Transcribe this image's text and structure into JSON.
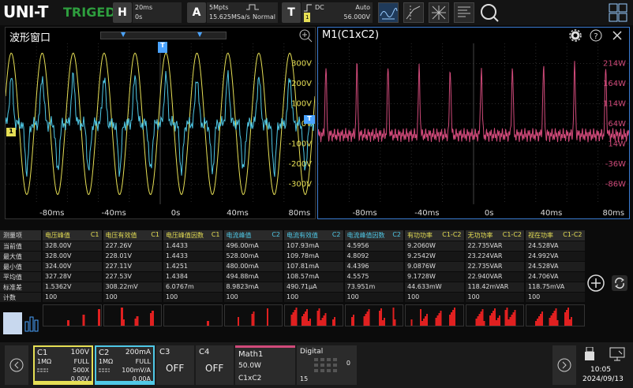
{
  "brand": {
    "name": "UNI-T",
    "status": "TRIGED"
  },
  "horizontal": {
    "letter": "H",
    "timebase": "20ms",
    "offset": "0s"
  },
  "acquire": {
    "letter": "A",
    "depth": "5Mpts",
    "rate": "15.625MSa/s",
    "mode": "Normal"
  },
  "trigger": {
    "letter": "T",
    "coupling": "DC",
    "sweep": "Auto",
    "level": "56.000V",
    "source": "1"
  },
  "tools": [
    "measure-wave-icon",
    "cursor-icon",
    "network-icon",
    "report-icon",
    "zoom-icon",
    "grid-layout-icon"
  ],
  "left_panel": {
    "title": "波形窗口",
    "y_ticks": [
      "300V",
      "200V",
      "100V",
      "0V",
      "-100V",
      "-200V",
      "-300V"
    ],
    "x_ticks": [
      "-80ms",
      "-40ms",
      "0s",
      "40ms",
      "80ms"
    ],
    "ch1_marker": "1",
    "trig_marker": "T"
  },
  "right_panel": {
    "title": "M1(C1xC2)",
    "y_ticks": [
      "214W",
      "164W",
      "114W",
      "64W",
      "14W",
      "-36W",
      "-86W"
    ],
    "x_ticks": [
      "-80ms",
      "-40ms",
      "0s",
      "40ms",
      "80ms"
    ]
  },
  "table": {
    "corner": "测量项",
    "row_labels": [
      "当前值",
      "最大值",
      "最小值",
      "平均值",
      "标准差",
      "计数"
    ],
    "columns": [
      {
        "name": "电压峰值",
        "ch": "C1",
        "color": "#e6df55",
        "values": [
          "328.00V",
          "328.00V",
          "324.00V",
          "327.28V",
          "1.5362V",
          "100"
        ]
      },
      {
        "name": "电压有效值",
        "ch": "C1",
        "color": "#e6df55",
        "values": [
          "227.26V",
          "228.01V",
          "227.11V",
          "227.53V",
          "308.22mV",
          "100"
        ]
      },
      {
        "name": "电压峰值因数",
        "ch": "C1",
        "color": "#e6df55",
        "values": [
          "1.4433",
          "1.4433",
          "1.4251",
          "1.4384",
          "6.0767m",
          "100"
        ]
      },
      {
        "name": "电流峰值",
        "ch": "C2",
        "color": "#4fc8e6",
        "values": [
          "496.00mA",
          "528.00mA",
          "480.00mA",
          "494.88mA",
          "8.9823mA",
          "100"
        ]
      },
      {
        "name": "电流有效值",
        "ch": "C2",
        "color": "#4fc8e6",
        "values": [
          "107.93mA",
          "109.78mA",
          "107.81mA",
          "108.57mA",
          "490.71µA",
          "100"
        ]
      },
      {
        "name": "电流峰值因数",
        "ch": "C2",
        "color": "#4fc8e6",
        "values": [
          "4.5956",
          "4.8092",
          "4.4396",
          "4.5575",
          "73.951m",
          "100"
        ]
      },
      {
        "name": "有功功率",
        "ch": "C1-C2",
        "color": "#e6df55",
        "values": [
          "9.2060W",
          "9.2542W",
          "9.0876W",
          "9.1728W",
          "44.633mW",
          "100"
        ]
      },
      {
        "name": "无功功率",
        "ch": "C1-C2",
        "color": "#e6df55",
        "values": [
          "22.735VAR",
          "23.224VAR",
          "22.735VAR",
          "22.940VAR",
          "118.42mVAR",
          "100"
        ]
      },
      {
        "name": "视在功率",
        "ch": "C1-C2",
        "color": "#e6df55",
        "values": [
          "24.528VA",
          "24.992VA",
          "24.528VA",
          "24.706VA",
          "118.75mVA",
          "100"
        ]
      }
    ]
  },
  "channels": {
    "c1": {
      "name": "C1",
      "scale": "100V",
      "impedance": "1MΩ",
      "bw": "FULL",
      "probe": "500X",
      "offset": "0.00V",
      "color": "#e6df55"
    },
    "c2": {
      "name": "C2",
      "scale": "200mA",
      "impedance": "1MΩ",
      "bw": "FULL",
      "probe": "100mV/A",
      "offset": "0.00A",
      "color": "#4fc8e6"
    },
    "c3": {
      "name": "C3",
      "state": "OFF"
    },
    "c4": {
      "name": "C4",
      "state": "OFF"
    },
    "math": {
      "name": "Math1",
      "scale": "50.0W",
      "expr": "C1xC2",
      "color": "#d04a7a"
    },
    "digital": {
      "name": "Digital",
      "d0": "0",
      "d15": "15"
    }
  },
  "clock": {
    "time": "10:05",
    "date": "2024/09/13"
  }
}
